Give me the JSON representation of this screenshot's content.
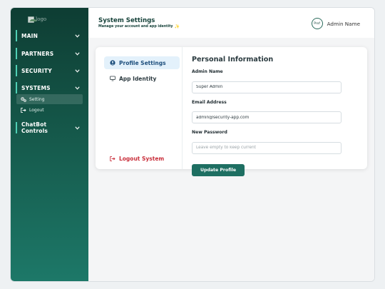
{
  "logo": {
    "alt": "logo",
    "icon": "broken-image-icon"
  },
  "sidebar": {
    "sections": [
      {
        "label": "MAIN",
        "icon": "chevron-down-icon"
      },
      {
        "label": "PARTNERS",
        "icon": "chevron-down-icon"
      },
      {
        "label": "SECURITY",
        "icon": "chevron-down-icon"
      },
      {
        "label": "SYSTEMS",
        "icon": "chevron-down-icon"
      },
      {
        "label": "ChatBot Controls",
        "icon": "chevron-down-icon"
      }
    ],
    "systems_items": [
      {
        "label": "Setting",
        "icon": "gears-icon",
        "active": true
      },
      {
        "label": "Logout",
        "icon": "logout-icon",
        "active": false
      }
    ],
    "accent": "#4fd0b5"
  },
  "header": {
    "title": "System Settings",
    "subtitle": "Manage your account and app identity",
    "subtitle_icon": "sparkle-icon",
    "user": {
      "avatar_text": "Prof",
      "name": "Admin Name"
    }
  },
  "settings": {
    "tabs": [
      {
        "label": "Profile Settings",
        "icon": "user-circle-icon",
        "active": true
      },
      {
        "label": "App Identity",
        "icon": "monitor-icon",
        "active": false
      }
    ],
    "logout_label": "Logout System",
    "form": {
      "title": "Personal Information",
      "admin_name_label": "Admin Name",
      "admin_name_value": "Super Admin",
      "email_label": "Email Address",
      "email_value": "admin@security-app.com",
      "password_label": "New Password",
      "password_placeholder": "Leave empty to keep current",
      "submit_label": "Update Profile"
    }
  },
  "colors": {
    "primary": "#1e6f62",
    "danger": "#c92f3b",
    "active_tab": "#e3f1fb"
  }
}
